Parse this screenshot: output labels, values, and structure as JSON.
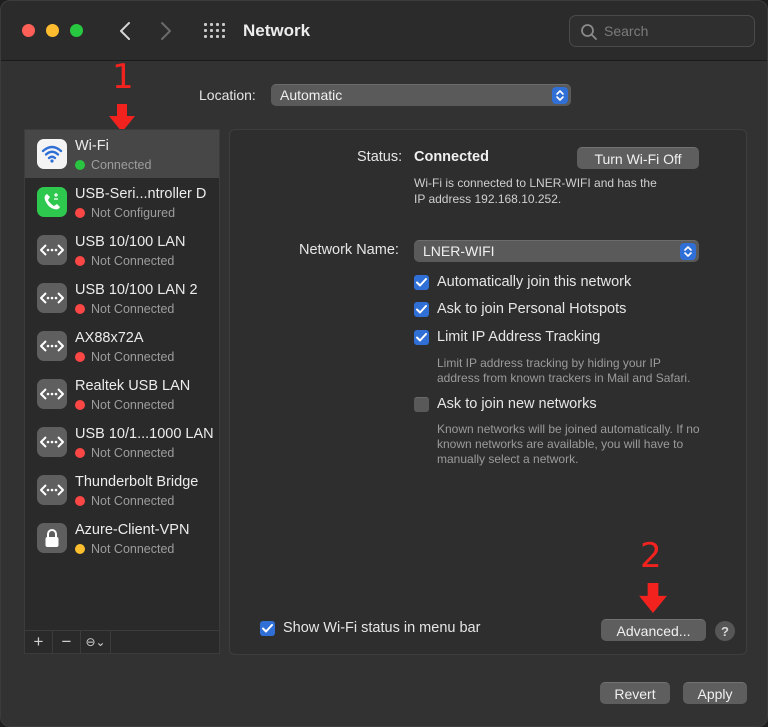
{
  "window": {
    "title": "Network"
  },
  "search": {
    "placeholder": "Search"
  },
  "location": {
    "label": "Location:",
    "value": "Automatic"
  },
  "services": [
    {
      "name": "Wi-Fi",
      "status": "Connected",
      "status_color": "green",
      "icon": "wifi-icon",
      "selected": true
    },
    {
      "name": "USB-Seri...ntroller D",
      "status": "Not Configured",
      "status_color": "red",
      "icon": "phone-icon"
    },
    {
      "name": "USB 10/100 LAN",
      "status": "Not Connected",
      "status_color": "red",
      "icon": "ethernet-icon"
    },
    {
      "name": "USB 10/100 LAN 2",
      "status": "Not Connected",
      "status_color": "red",
      "icon": "ethernet-icon"
    },
    {
      "name": "AX88x72A",
      "status": "Not Connected",
      "status_color": "red",
      "icon": "ethernet-icon"
    },
    {
      "name": "Realtek USB LAN",
      "status": "Not Connected",
      "status_color": "red",
      "icon": "ethernet-icon"
    },
    {
      "name": "USB 10/1...1000 LAN",
      "status": "Not Connected",
      "status_color": "red",
      "icon": "ethernet-icon"
    },
    {
      "name": "Thunderbolt Bridge",
      "status": "Not Connected",
      "status_color": "red",
      "icon": "ethernet-icon"
    },
    {
      "name": "Azure-Client-VPN",
      "status": "Not Connected",
      "status_color": "yellow",
      "icon": "lock-icon"
    }
  ],
  "sidebar_bar": {
    "add": "+",
    "remove": "−",
    "actions": "⊖⌄"
  },
  "detail": {
    "status_label": "Status:",
    "status_value": "Connected",
    "toggle_button": "Turn Wi-Fi Off",
    "status_desc_line1": "Wi-Fi is connected to LNER-WIFI and has the",
    "status_desc_line2": "IP address 192.168.10.252.",
    "network_name_label": "Network Name:",
    "network_name_value": "LNER-WIFI",
    "options": [
      {
        "label": "Automatically join this network",
        "checked": true
      },
      {
        "label": "Ask to join Personal Hotspots",
        "checked": true
      },
      {
        "label": "Limit IP Address Tracking",
        "checked": true
      },
      {
        "label": "Ask to join new networks",
        "checked": false
      }
    ],
    "limit_ip_help_line1": "Limit IP address tracking by hiding your IP",
    "limit_ip_help_line2": "address from known trackers in Mail and Safari.",
    "new_networks_help_line1": "Known networks will be joined automatically. If no",
    "new_networks_help_line2": "known networks are available, you will have to",
    "new_networks_help_line3": "manually select a network.",
    "menu_bar_checkbox": "Show Wi-Fi status in menu bar",
    "menu_bar_checked": true,
    "advanced_button": "Advanced...",
    "help_button": "?"
  },
  "footer": {
    "revert": "Revert",
    "apply": "Apply"
  },
  "annotations": {
    "marker1": "1",
    "marker2": "2",
    "color": "#f2231f"
  },
  "colors": {
    "accent": "#2f6fd6",
    "connected": "#29c440",
    "disconnected": "#fd4646",
    "vpn": "#fdbf2d"
  }
}
